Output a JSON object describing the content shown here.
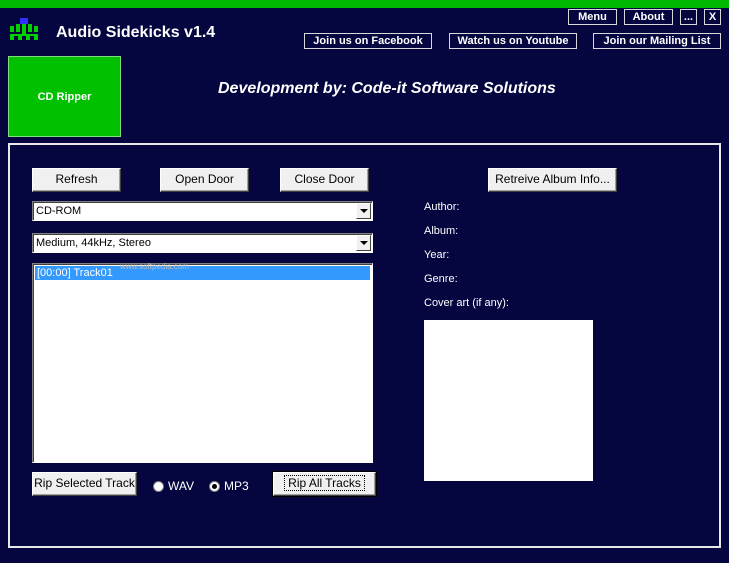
{
  "app": {
    "title": "Audio Sidekicks v1.4",
    "accent_color": "#00b800",
    "background_color": "#05053f"
  },
  "header": {
    "menu_label": "Menu",
    "about_label": "About",
    "minimize_label": "...",
    "close_label": "X",
    "links": {
      "facebook": "Join us on Facebook",
      "youtube": "Watch us on Youtube",
      "mailing_list": "Join our Mailing List"
    }
  },
  "nav": {
    "active_tab": "CD Ripper"
  },
  "banner": {
    "text": "Development by: Code-it Software Solutions"
  },
  "ripper": {
    "buttons": {
      "refresh": "Refresh",
      "open_door": "Open Door",
      "close_door": "Close Door",
      "retrieve_album_info": "Retreive Album Info...",
      "rip_selected": "Rip Selected Track",
      "rip_all": "Rip All Tracks"
    },
    "drive_select": {
      "value": "CD-ROM"
    },
    "quality_select": {
      "value": "Medium, 44kHz, Stereo"
    },
    "tracks": [
      {
        "label": "[00:00] Track01",
        "selected": true
      }
    ],
    "format": {
      "options": [
        "WAV",
        "MP3"
      ],
      "selected": "MP3"
    }
  },
  "album_info": {
    "author_label": "Author:",
    "album_label": "Album:",
    "year_label": "Year:",
    "genre_label": "Genre:",
    "cover_label": "Cover art (if any):"
  },
  "watermark": "www.softpedia.com"
}
